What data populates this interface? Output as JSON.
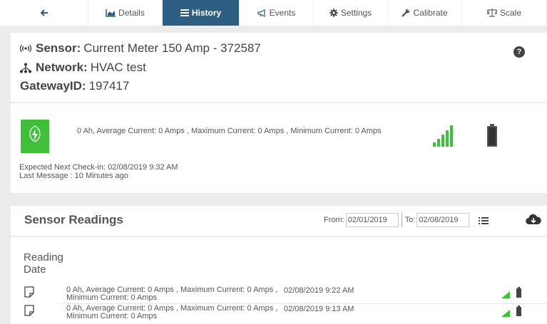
{
  "tabs": [
    {
      "label": "",
      "icon": "back-arrow-icon",
      "active": false
    },
    {
      "label": "Details",
      "icon": "chart-icon",
      "active": false
    },
    {
      "label": "History",
      "icon": "list-icon",
      "active": true
    },
    {
      "label": "Events",
      "icon": "megaphone-icon",
      "active": false
    },
    {
      "label": "Settings",
      "icon": "gear-icon",
      "active": false
    },
    {
      "label": "Calibrate",
      "icon": "wrench-icon",
      "active": false
    },
    {
      "label": "Scale",
      "icon": "balance-icon",
      "active": false
    }
  ],
  "sensor": {
    "sensor_label": "Sensor:",
    "sensor_value": "Current Meter 150 Amp - 372587",
    "network_label": "Network:",
    "network_value": "HVAC test",
    "gateway_label": "GatewayID:",
    "gateway_value": "197417",
    "reading": "0 Ah, Average Current: 0 Amps , Maximum Current: 0 Amps , Minimum Current: 0 Amps",
    "next_checkin": "Expected Next Check-in: 02/08/2019 9:32 AM",
    "last_message": "Last Message : 10 Minutes ago",
    "status_color": "#3fbf3a",
    "signal_color": "#3fbf3a"
  },
  "readings": {
    "title": "Sensor Readings",
    "from_label": "From:",
    "from_value": "02/01/2019",
    "to_label": "To:",
    "to_value": "02/08/2019",
    "column_header": "Reading Date",
    "rows": [
      {
        "text": "0 Ah, Average Current: 0 Amps , Maximum Current: 0 Amps , Minimum Current: 0 Amps",
        "date": "02/08/2019 9:22 AM"
      },
      {
        "text": "0 Ah, Average Current: 0 Amps , Maximum Current: 0 Amps , Minimum Current: 0 Amps",
        "date": "02/08/2019 9:13 AM"
      }
    ]
  },
  "colors": {
    "active_tab": "#2f5e83",
    "ok_green": "#3fbf3a"
  }
}
